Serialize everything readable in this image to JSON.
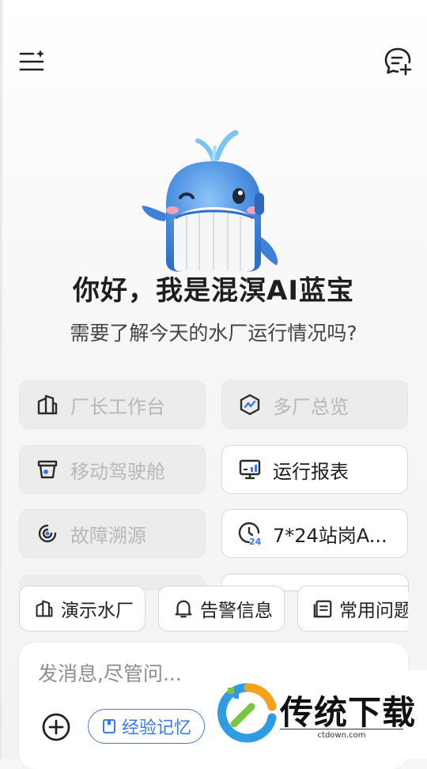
{
  "header": {
    "menu_icon": "menu-sparkle-icon",
    "new_chat_icon": "chat-plus-icon"
  },
  "hero": {
    "mascot": "whale-mascot",
    "greeting": "你好，我是混溟AI蓝宝",
    "subtitle": "需要了解今天的水厂运行情况吗?"
  },
  "shortcuts": [
    {
      "label": "厂长工作台",
      "icon": "factory-building-icon",
      "enabled": false
    },
    {
      "label": "多厂总览",
      "icon": "hexagon-chart-icon",
      "enabled": false
    },
    {
      "label": "移动驾驶舱",
      "icon": "cup-dashboard-icon",
      "enabled": false
    },
    {
      "label": "运行报表",
      "icon": "monitor-chart-icon",
      "enabled": true
    },
    {
      "label": "故障溯源",
      "icon": "target-trace-icon",
      "enabled": false
    },
    {
      "label": "7*24站岗A...",
      "icon": "clock-24-icon",
      "enabled": true
    }
  ],
  "chips": [
    {
      "label": "演示水厂",
      "icon": "factory-building-icon"
    },
    {
      "label": "告警信息",
      "icon": "bell-icon"
    },
    {
      "label": "常用问题",
      "icon": "document-list-icon"
    }
  ],
  "composer": {
    "placeholder": "发消息,尽管问...",
    "plus_icon": "plus-circle-icon",
    "memory_label": "经验记忆",
    "memory_icon": "bookmark-book-icon"
  },
  "watermark": {
    "text": "传统下载",
    "url": "ctdown.com"
  },
  "colors": {
    "accent": "#3a78ee",
    "disabled_text": "#b7b7b9",
    "mascot_blue": "#4a8fe0"
  }
}
